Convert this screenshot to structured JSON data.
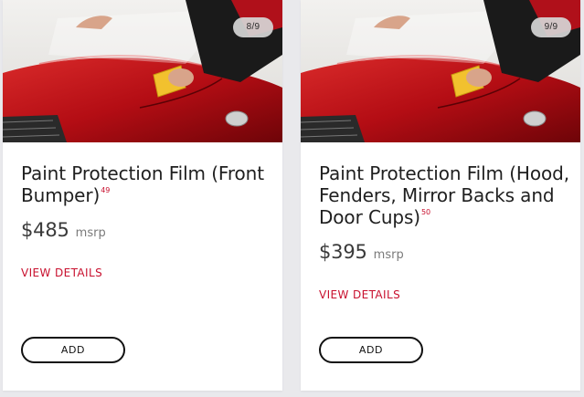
{
  "cards": [
    {
      "counter": "8/9",
      "title": "Paint Protection Film (Front Bumper)",
      "footnote": "49",
      "price": "$485",
      "price_suffix": "msrp",
      "details_label": "VIEW DETAILS",
      "add_label": "ADD"
    },
    {
      "counter": "9/9",
      "title": "Paint Protection Film (Hood, Fenders, Mirror Backs and Door Cups)",
      "footnote": "50",
      "price": "$395",
      "price_suffix": "msrp",
      "details_label": "VIEW DETAILS",
      "add_label": "ADD"
    }
  ],
  "colors": {
    "accent_red": "#c8102e",
    "car_red": "#c0101a",
    "page_bg": "#e9e9ec"
  }
}
